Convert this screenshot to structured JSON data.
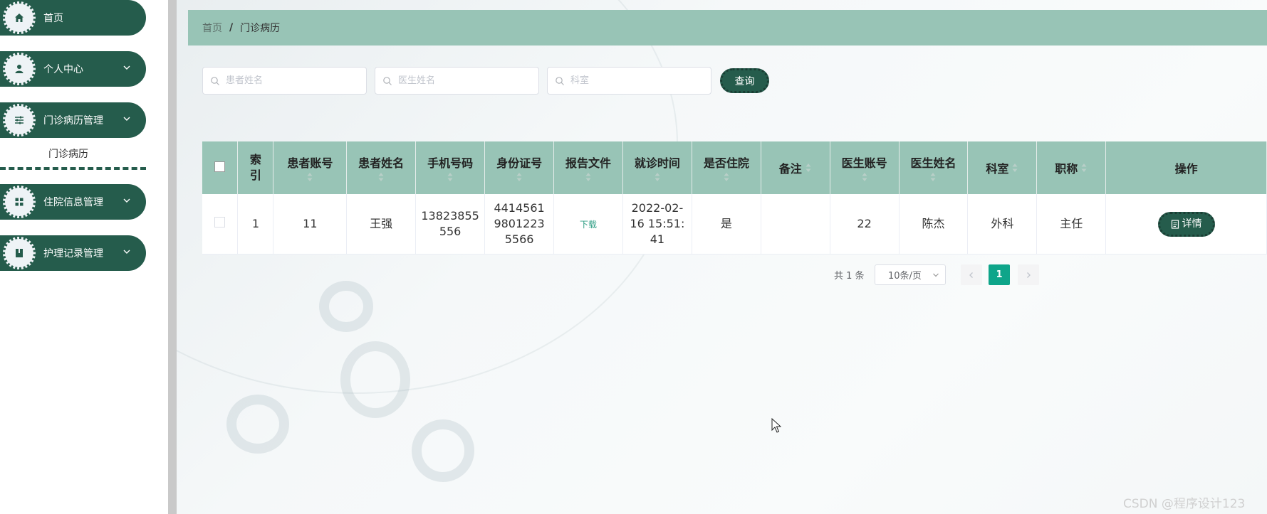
{
  "sidebar": {
    "items": [
      {
        "label": "首页",
        "icon": "home-icon"
      },
      {
        "label": "个人中心",
        "icon": "user-icon"
      },
      {
        "label": "门诊病历管理",
        "icon": "sliders-icon"
      },
      {
        "label": "住院信息管理",
        "icon": "grid-icon"
      },
      {
        "label": "护理记录管理",
        "icon": "book-icon"
      }
    ],
    "submenu": {
      "label": "门诊病历"
    }
  },
  "breadcrumb": {
    "home": "首页",
    "separator": "/",
    "current": "门诊病历"
  },
  "search": {
    "patient_name_placeholder": "患者姓名",
    "doctor_name_placeholder": "医生姓名",
    "department_placeholder": "科室",
    "query_label": "查询"
  },
  "table": {
    "headers": [
      "索引",
      "患者账号",
      "患者姓名",
      "手机号码",
      "身份证号",
      "报告文件",
      "就诊时间",
      "是否住院",
      "备注",
      "医生账号",
      "医生姓名",
      "科室",
      "职称",
      "操作"
    ],
    "rows": [
      {
        "index": "1",
        "patient_account": "11",
        "patient_name": "王强",
        "phone": "13823855556",
        "id_number": "441456198012235566",
        "report_file": "下载",
        "visit_time": "2022-02-16 15:51:41",
        "hospitalized": "是",
        "remark": "",
        "doctor_account": "22",
        "doctor_name": "陈杰",
        "department": "外科",
        "title": "主任",
        "action": "详情"
      }
    ]
  },
  "pagination": {
    "total": "共 1 条",
    "page_size": "10条/页",
    "current_page": "1"
  },
  "watermark": "CSDN @程序设计123",
  "colors": {
    "primary": "#255c4c",
    "header_bg": "#98c4b6",
    "page_active": "#0ea58a"
  }
}
